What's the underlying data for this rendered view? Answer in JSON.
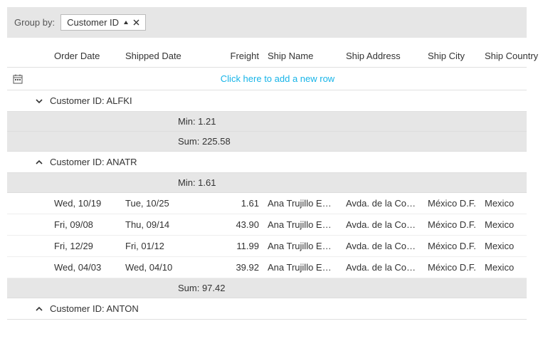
{
  "groupPanel": {
    "label": "Group by:",
    "chip": {
      "text": "Customer ID"
    }
  },
  "columns": {
    "orderDate": "Order Date",
    "shippedDate": "Shipped Date",
    "freight": "Freight",
    "shipName": "Ship Name",
    "shipAddress": "Ship Address",
    "shipCity": "Ship City",
    "shipCountry": "Ship Country"
  },
  "newRowPrompt": "Click here to add a new row",
  "groups": [
    {
      "caption": "Customer ID: ALFKI",
      "expanded": false,
      "minLabel": "Min: 1.21",
      "sumLabel": "Sum: 225.58",
      "rows": []
    },
    {
      "caption": "Customer ID: ANATR",
      "expanded": true,
      "minLabel": "Min: 1.61",
      "sumLabel": "Sum: 97.42",
      "rows": [
        {
          "orderDate": "Wed, 10/19",
          "shippedDate": "Tue, 10/25",
          "freight": "1.61",
          "shipName": "Ana Trujillo Emp...",
          "shipAddress": "Avda. de la Cons...",
          "shipCity": "México D.F.",
          "shipCountry": "Mexico"
        },
        {
          "orderDate": "Fri, 09/08",
          "shippedDate": "Thu, 09/14",
          "freight": "43.90",
          "shipName": "Ana Trujillo Emp...",
          "shipAddress": "Avda. de la Cons...",
          "shipCity": "México D.F.",
          "shipCountry": "Mexico"
        },
        {
          "orderDate": "Fri, 12/29",
          "shippedDate": "Fri, 01/12",
          "freight": "11.99",
          "shipName": "Ana Trujillo Emp...",
          "shipAddress": "Avda. de la Cons...",
          "shipCity": "México D.F.",
          "shipCountry": "Mexico"
        },
        {
          "orderDate": "Wed, 04/03",
          "shippedDate": "Wed, 04/10",
          "freight": "39.92",
          "shipName": "Ana Trujillo Emp...",
          "shipAddress": "Avda. de la Cons...",
          "shipCity": "México D.F.",
          "shipCountry": "Mexico"
        }
      ]
    },
    {
      "caption": "Customer ID: ANTON",
      "expanded": true,
      "minLabel": "",
      "sumLabel": "",
      "rows": []
    }
  ]
}
